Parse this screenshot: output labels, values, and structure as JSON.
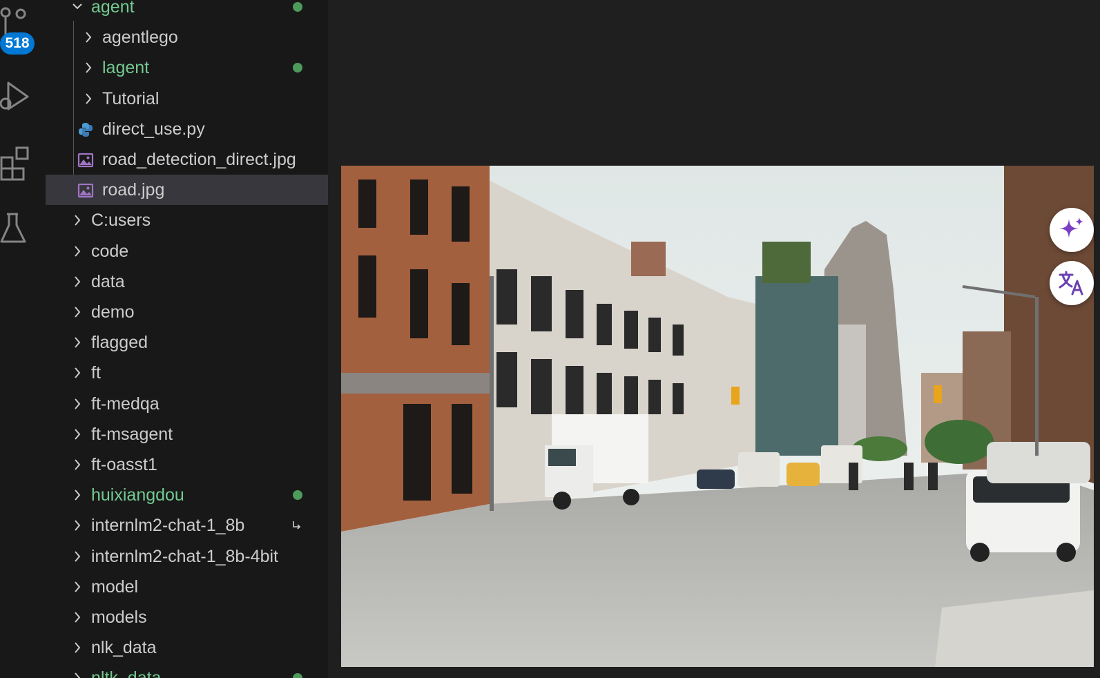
{
  "activity_bar": {
    "source_control_badge": "518",
    "icons": [
      "source-control-icon",
      "run-debug-icon",
      "extensions-icon",
      "testing-icon"
    ]
  },
  "explorer": {
    "items": [
      {
        "label": "agent",
        "kind": "folder",
        "expanded": true,
        "level": 0,
        "git_modified": true
      },
      {
        "label": "agentlego",
        "kind": "folder",
        "level": 1
      },
      {
        "label": "lagent",
        "kind": "folder",
        "level": 1,
        "git_modified": true
      },
      {
        "label": "Tutorial",
        "kind": "folder",
        "level": 1
      },
      {
        "label": "direct_use.py",
        "kind": "python-file",
        "level": 1
      },
      {
        "label": "road_detection_direct.jpg",
        "kind": "image-file",
        "level": 1
      },
      {
        "label": "road.jpg",
        "kind": "image-file",
        "level": 1,
        "selected": true
      },
      {
        "label": "C:users",
        "kind": "folder",
        "level": 0
      },
      {
        "label": "code",
        "kind": "folder",
        "level": 0
      },
      {
        "label": "data",
        "kind": "folder",
        "level": 0
      },
      {
        "label": "demo",
        "kind": "folder",
        "level": 0
      },
      {
        "label": "flagged",
        "kind": "folder",
        "level": 0
      },
      {
        "label": "ft",
        "kind": "folder",
        "level": 0
      },
      {
        "label": "ft-medqa",
        "kind": "folder",
        "level": 0
      },
      {
        "label": "ft-msagent",
        "kind": "folder",
        "level": 0
      },
      {
        "label": "ft-oasst1",
        "kind": "folder",
        "level": 0
      },
      {
        "label": "huixiangdou",
        "kind": "folder",
        "level": 0,
        "git_modified": true
      },
      {
        "label": "internlm2-chat-1_8b",
        "kind": "folder",
        "level": 0,
        "symlink": true
      },
      {
        "label": "internlm2-chat-1_8b-4bit",
        "kind": "folder",
        "level": 0
      },
      {
        "label": "model",
        "kind": "folder",
        "level": 0
      },
      {
        "label": "models",
        "kind": "folder",
        "level": 0
      },
      {
        "label": "nlk_data",
        "kind": "folder",
        "level": 0
      },
      {
        "label": "nltk_data",
        "kind": "folder",
        "level": 0,
        "git_modified": true
      }
    ]
  },
  "editor": {
    "image_preview": "road.jpg"
  },
  "floating_buttons": [
    "sparkle-ai-icon",
    "translate-icon"
  ],
  "colors": {
    "accent_badge": "#0078d4",
    "git_modified": "#73c991",
    "selection": "#37373d",
    "image_icon": "#a074c4",
    "python_icon": "#4b9cd3"
  }
}
